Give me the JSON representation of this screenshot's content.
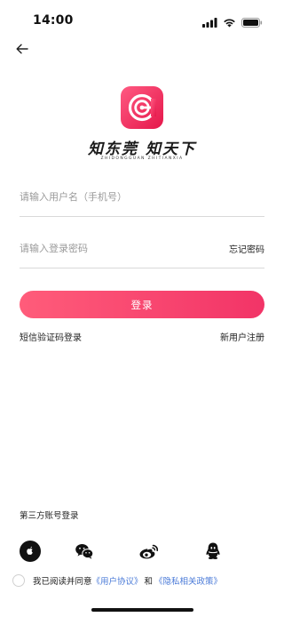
{
  "status_bar": {
    "time": "14:00",
    "icons": [
      "signal-icon",
      "wifi-icon",
      "battery-icon"
    ]
  },
  "header": {
    "back_icon": "arrow-left-icon"
  },
  "brand": {
    "logo_icon": "eye-logo-icon",
    "slogan_cn": "知东莞 知天下",
    "slogan_en": "ZHIDONGGUAN ZHITIANXIA",
    "colors": {
      "logo_gradient_start": "#ff4f7a",
      "logo_gradient_end": "#e8194d"
    }
  },
  "form": {
    "username_placeholder": "请输入用户名（手机号）",
    "password_placeholder": "请输入登录密码",
    "forgot_password": "忘记密码",
    "login_button": "登录",
    "sms_login": "短信验证码登录",
    "register": "新用户注册"
  },
  "third_party": {
    "title": "第三方账号登录",
    "providers": [
      "apple-icon",
      "wechat-icon",
      "weibo-icon",
      "qq-icon"
    ]
  },
  "agreement": {
    "prefix": "我已阅读并同意",
    "user_agreement": "《用户协议》",
    "and": "和",
    "privacy_policy": "《隐私相关政策》",
    "checked": false
  },
  "theme": {
    "accent": "#f23467",
    "link": "#4b7bd8"
  }
}
